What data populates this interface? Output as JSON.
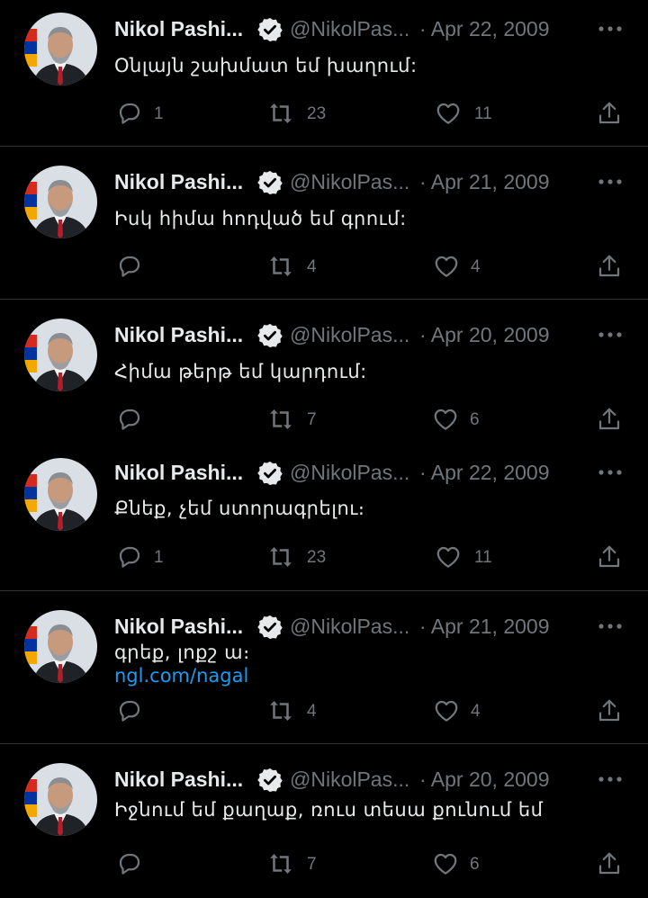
{
  "tweets": [
    {
      "author_name": "Nikol Pashi...",
      "handle": "@NikolPas...",
      "date": "· Apr 22, 2009",
      "text": "Օնլայն շախմատ եմ խաղում:",
      "link": "",
      "replies": "1",
      "retweets": "23",
      "likes": "11"
    },
    {
      "author_name": "Nikol Pashi...",
      "handle": "@NikolPas...",
      "date": "· Apr 21, 2009",
      "text": "Իսկ հիմա հոդված եմ գրում:",
      "link": "",
      "replies": "",
      "retweets": "4",
      "likes": "4"
    },
    {
      "author_name": "Nikol Pashi...",
      "handle": "@NikolPas...",
      "date": "· Apr 20, 2009",
      "text": "Հիմա թերթ եմ կարդում:",
      "link": "",
      "replies": "",
      "retweets": "7",
      "likes": "6"
    },
    {
      "author_name": "Nikol Pashi...",
      "handle": "@NikolPas...",
      "date": "· Apr 22, 2009",
      "text": "Քնեք, չեմ ստորագրելու։",
      "link": "",
      "replies": "1",
      "retweets": "23",
      "likes": "11"
    },
    {
      "author_name": "Nikol Pashi...",
      "handle": "@NikolPas...",
      "date": "· Apr 21, 2009",
      "text": "գրեք, լոքշ ա։",
      "link": "ngl.com/nagal",
      "replies": "",
      "retweets": "4",
      "likes": "4"
    },
    {
      "author_name": "Nikol Pashi...",
      "handle": "@NikolPas...",
      "date": "· Apr 20, 2009",
      "text": "Իջնում եմ քաղաք, ռուս տեսա քունում եմ",
      "link": "",
      "replies": "",
      "retweets": "7",
      "likes": "6"
    }
  ],
  "icons": {
    "verified": "verified-badge-icon",
    "more": "more-options-icon",
    "reply": "reply-icon",
    "retweet": "retweet-icon",
    "like": "like-icon",
    "share": "share-icon"
  },
  "colors": {
    "background": "#000000",
    "text_primary": "#e7e9ea",
    "text_secondary": "#71767b",
    "link": "#1d9bf0",
    "divider": "#2f3336"
  }
}
